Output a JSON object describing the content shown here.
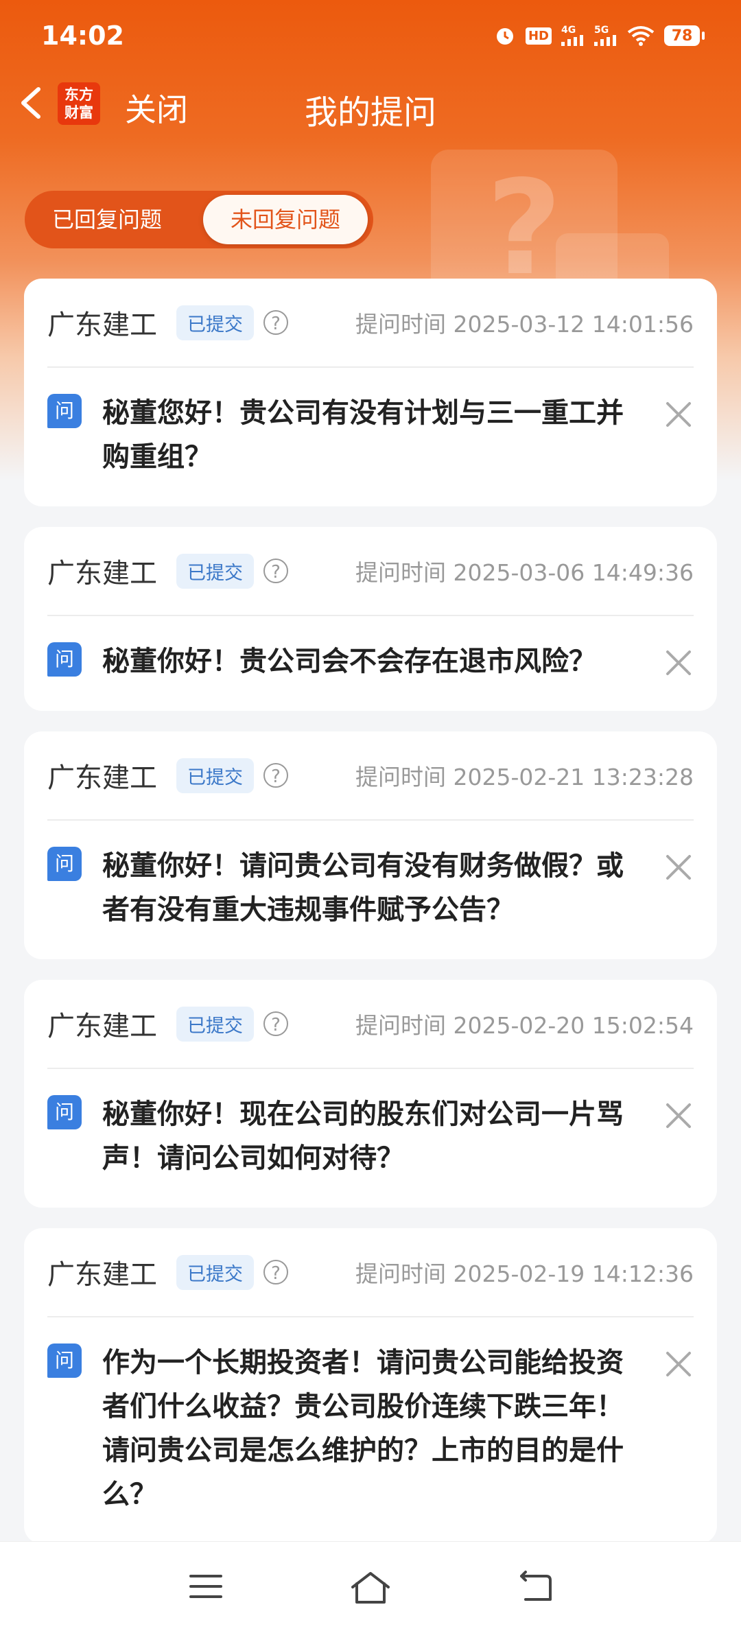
{
  "status_bar": {
    "time": "14:02",
    "battery": "78",
    "network_1": "4G",
    "network_2": "5G",
    "hd_label": "HD"
  },
  "nav": {
    "back_icon": "chevron-left-icon",
    "logo_line1": "东方",
    "logo_line2": "财富",
    "close_label": "关闭",
    "title": "我的提问"
  },
  "tabs": {
    "answered": "已回复问题",
    "unanswered": "未回复问题",
    "active": "unanswered"
  },
  "questions": [
    {
      "company": "广东建工",
      "status": "已提交",
      "time": "提问时间 2025-03-12 14:01:56",
      "icon_label": "问",
      "text": "秘董您好！贵公司有没有计划与三一重工并购重组？"
    },
    {
      "company": "广东建工",
      "status": "已提交",
      "time": "提问时间 2025-03-06 14:49:36",
      "icon_label": "问",
      "text": "秘董你好！贵公司会不会存在退市风险？"
    },
    {
      "company": "广东建工",
      "status": "已提交",
      "time": "提问时间 2025-02-21 13:23:28",
      "icon_label": "问",
      "text": "秘董你好！请问贵公司有没有财务做假？或者有没有重大违规事件赋予公告？"
    },
    {
      "company": "广东建工",
      "status": "已提交",
      "time": "提问时间 2025-02-20 15:02:54",
      "icon_label": "问",
      "text": "秘董你好！现在公司的股东们对公司一片骂声！请问公司如何对待？"
    },
    {
      "company": "广东建工",
      "status": "已提交",
      "time": "提问时间 2025-02-19 14:12:36",
      "icon_label": "问",
      "text": "作为一个长期投资者！请问贵公司能给投资者们什么收益？贵公司股价连续下跌三年！请问贵公司是怎么维护的？上市的目的是什么？"
    }
  ],
  "help_symbol": "?",
  "colors": {
    "brand_orange": "#ec5a0e",
    "question_icon_blue": "#3a7fe0",
    "badge_blue": "#3b78c8"
  }
}
